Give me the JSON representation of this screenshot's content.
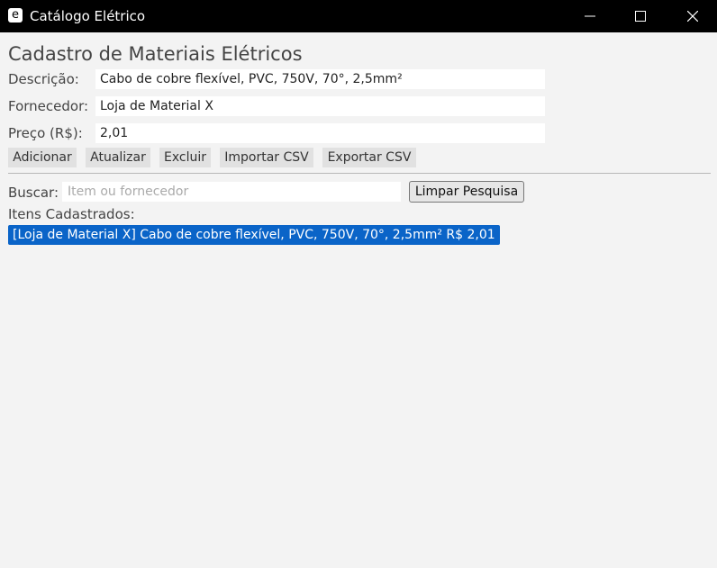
{
  "window": {
    "app_icon_glyph": "e",
    "title": "Catálogo Elétrico",
    "controls": [
      "minimize-icon",
      "maximize-icon",
      "close-icon"
    ]
  },
  "form": {
    "heading": "Cadastro de Materiais Elétricos",
    "descricao_label": "Descrição:",
    "descricao_value": "Cabo de cobre flexível, PVC, 750V, 70°, 2,5mm²",
    "fornecedor_label": "Fornecedor:",
    "fornecedor_value": "Loja de Material X",
    "preco_label": "Preço (R$):",
    "preco_value": "2,01"
  },
  "actions": {
    "add": "Adicionar",
    "update": "Atualizar",
    "delete": "Excluir",
    "import": "Importar CSV",
    "export": "Exportar CSV"
  },
  "search": {
    "label": "Buscar:",
    "placeholder": "Item ou fornecedor",
    "value": "",
    "clear_button": "Limpar Pesquisa"
  },
  "list": {
    "label": "Itens Cadastrados:",
    "items": [
      {
        "text": "[Loja de Material X] Cabo de cobre flexível, PVC, 750V, 70°, 2,5mm² R$ 2,01",
        "selected": true
      }
    ]
  },
  "colors": {
    "titlebar": "#000000",
    "background": "#f3f3f3",
    "selection": "#0a64c8"
  }
}
